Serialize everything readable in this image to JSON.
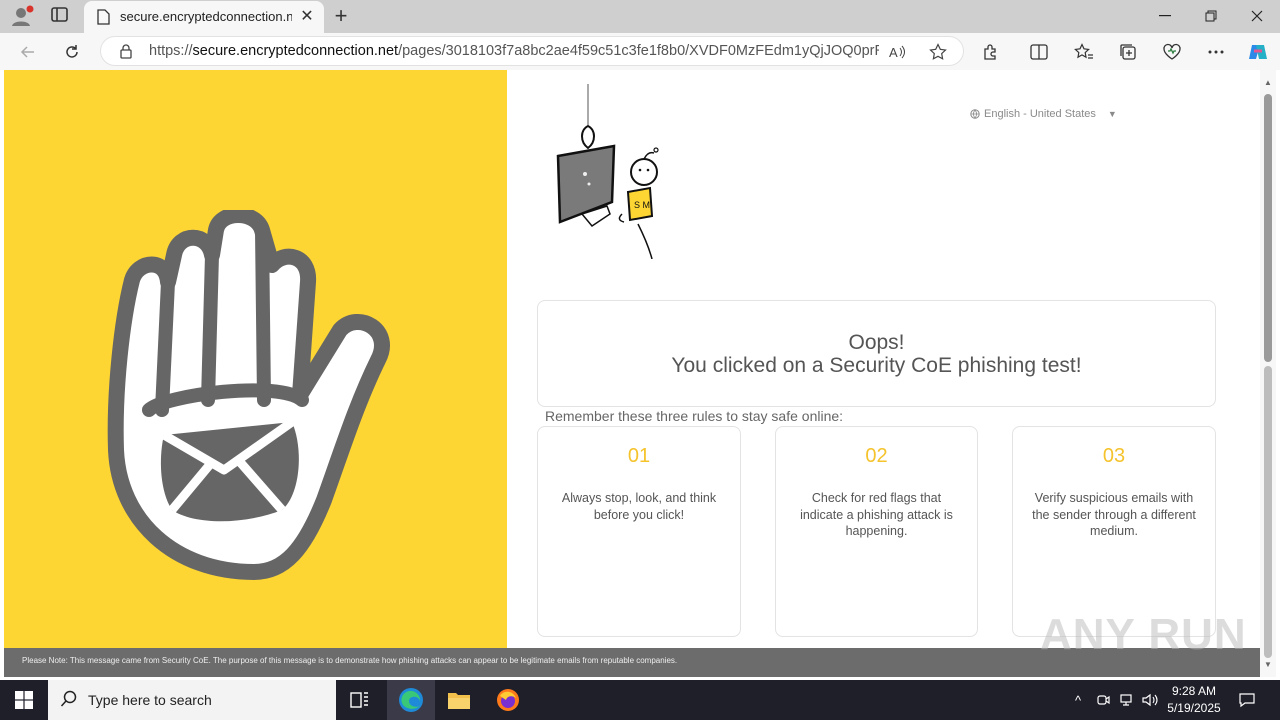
{
  "browser": {
    "tab_title": "secure.encryptedconnection.net/",
    "url_prefix": "https://",
    "url_host": "secure.encryptedconnection.net",
    "url_path": "/pages/3018103f7a8bc2ae4f59c51c3fe1f8b0/XVDF0MzFEdm1yQjJOQ0prRzV..."
  },
  "page": {
    "language": "English - United States",
    "oops_title": "Oops!",
    "oops_subtitle": "You clicked on a Security CoE phishing test!",
    "rules_intro": "Remember these three rules to stay safe online:",
    "rules": [
      {
        "number": "01",
        "text": "Always stop, look, and think before you click!"
      },
      {
        "number": "02",
        "text": "Check for red flags that indicate a phishing attack is happening."
      },
      {
        "number": "03",
        "text": "Verify suspicious emails with the sender through a different medium."
      }
    ],
    "footer_note": "Please Note: This message came from Security CoE. The purpose of this message is to demonstrate how phishing attacks can appear to be legitimate emails from reputable companies.",
    "colors": {
      "accent_yellow": "#fed633",
      "rule_number": "#f5c32c",
      "hand_gray": "#666666"
    }
  },
  "watermark": "ANY RUN",
  "taskbar": {
    "search_placeholder": "Type here to search",
    "time": "9:28 AM",
    "date": "5/19/2025"
  }
}
